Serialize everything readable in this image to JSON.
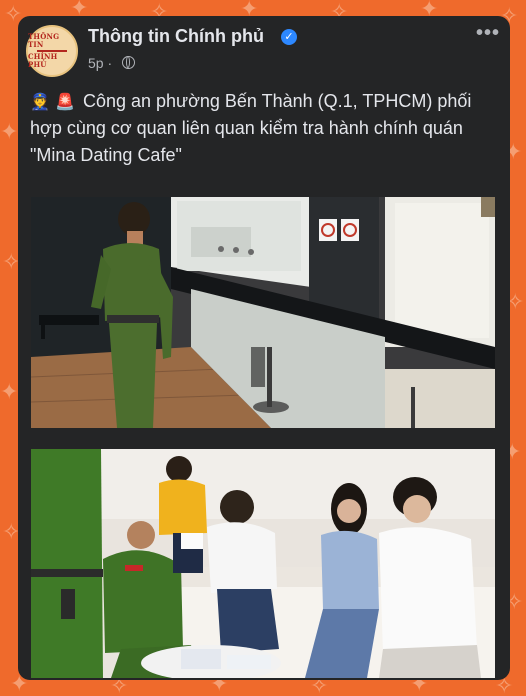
{
  "post": {
    "page_name": "Thông tin Chính phủ",
    "logo_line1": "THÔNG TIN",
    "logo_line2": "CHÍNH PHỦ",
    "time": "5p ·",
    "emoji": "👮 🚨",
    "caption": "Công an phường Bến Thành (Q.1, TPHCM) phối hợp cùng cơ quan liên quan kiểm tra hành chính quán \"Mina Dating Cafe\"",
    "more_label": "•••"
  },
  "icons": [
    "verified-badge-icon",
    "globe-icon",
    "more-options-icon",
    "police-emoji-icon",
    "siren-emoji-icon"
  ],
  "colors": {
    "background": "#ef6a2c",
    "card": "#242526",
    "text": "#e4e6eb",
    "muted": "#b0b3b8",
    "verified": "#2d88ff"
  }
}
